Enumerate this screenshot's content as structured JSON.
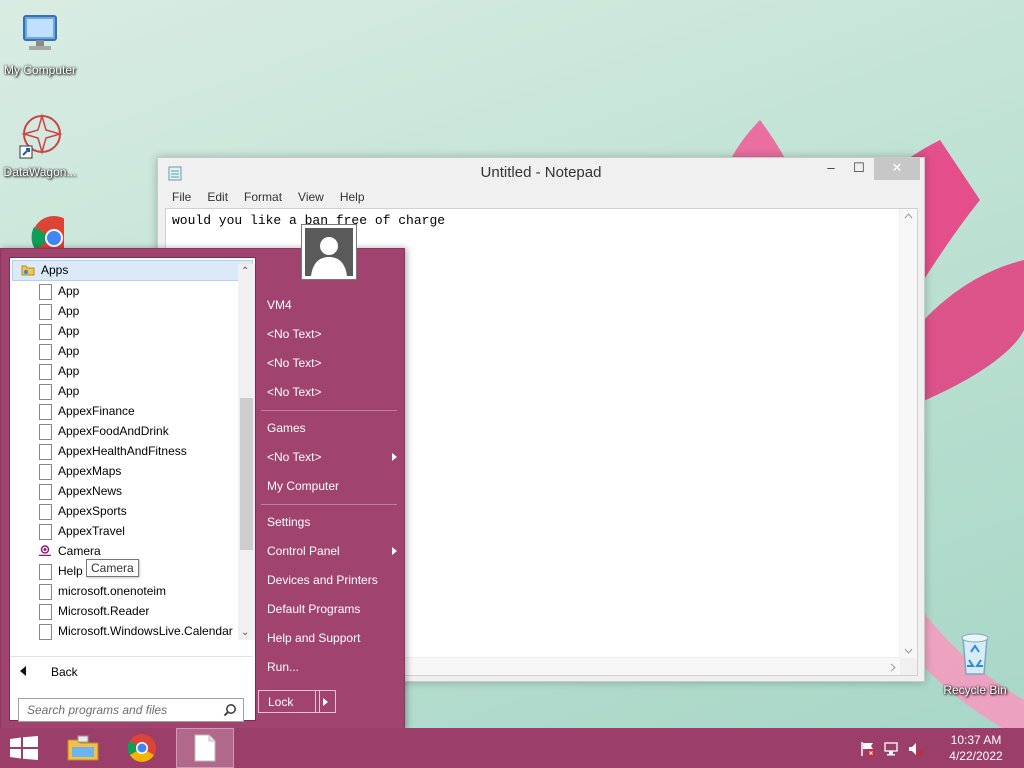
{
  "desktop": {
    "icons": [
      {
        "label": "My Computer",
        "icon": "computer-icon"
      },
      {
        "label": "DataWagon...",
        "icon": "app-shortcut-icon"
      },
      {
        "label": "Recycle Bin",
        "icon": "recycle-bin-icon"
      }
    ]
  },
  "notepad": {
    "title": "Untitled - Notepad",
    "menu": [
      "File",
      "Edit",
      "Format",
      "View",
      "Help"
    ],
    "content": "would you like a ban free of charge",
    "controls": {
      "minimize": "–",
      "maximize": "☐",
      "close": "✕"
    }
  },
  "start_menu": {
    "apps_header": "Apps",
    "apps": [
      {
        "label": "App",
        "icon": "document-icon"
      },
      {
        "label": "App",
        "icon": "document-icon"
      },
      {
        "label": "App",
        "icon": "document-icon"
      },
      {
        "label": "App",
        "icon": "document-icon"
      },
      {
        "label": "App",
        "icon": "document-icon"
      },
      {
        "label": "App",
        "icon": "document-icon"
      },
      {
        "label": "AppexFinance",
        "icon": "document-icon"
      },
      {
        "label": "AppexFoodAndDrink",
        "icon": "document-icon"
      },
      {
        "label": "AppexHealthAndFitness",
        "icon": "document-icon"
      },
      {
        "label": "AppexMaps",
        "icon": "document-icon"
      },
      {
        "label": "AppexNews",
        "icon": "document-icon"
      },
      {
        "label": "AppexSports",
        "icon": "document-icon"
      },
      {
        "label": "AppexTravel",
        "icon": "document-icon"
      },
      {
        "label": "Camera",
        "icon": "camera-icon"
      },
      {
        "label": "Help",
        "icon": "document-icon"
      },
      {
        "label": "microsoft.onenoteim",
        "icon": "document-icon"
      },
      {
        "label": "Microsoft.Reader",
        "icon": "document-icon"
      },
      {
        "label": "Microsoft.WindowsLive.Calendar",
        "icon": "document-icon"
      }
    ],
    "tooltip": "Camera",
    "back_label": "Back",
    "search_placeholder": "Search programs and files",
    "right_items": {
      "user": "VM4",
      "no_text_1": "<No Text>",
      "no_text_2": "<No Text>",
      "no_text_3": "<No Text>",
      "games": "Games",
      "no_text_4": "<No Text>",
      "my_computer": "My Computer",
      "settings": "Settings",
      "control_panel": "Control Panel",
      "devices_printers": "Devices and Printers",
      "default_programs": "Default Programs",
      "help_support": "Help and Support",
      "run": "Run..."
    },
    "lock_label": "Lock"
  },
  "taskbar": {
    "pinned": [
      "windows-logo-icon",
      "file-explorer-icon",
      "chrome-icon",
      "notepad-icon"
    ],
    "tray_icons": [
      "action-center-flag-icon",
      "network-icon",
      "volume-muted-icon"
    ],
    "time": "10:37 AM",
    "date": "4/22/2022"
  },
  "colors": {
    "start_menu_bg": "#a0436f",
    "taskbar_bg": "#9b3e69",
    "desktop_bg": "#bfe2d4"
  }
}
